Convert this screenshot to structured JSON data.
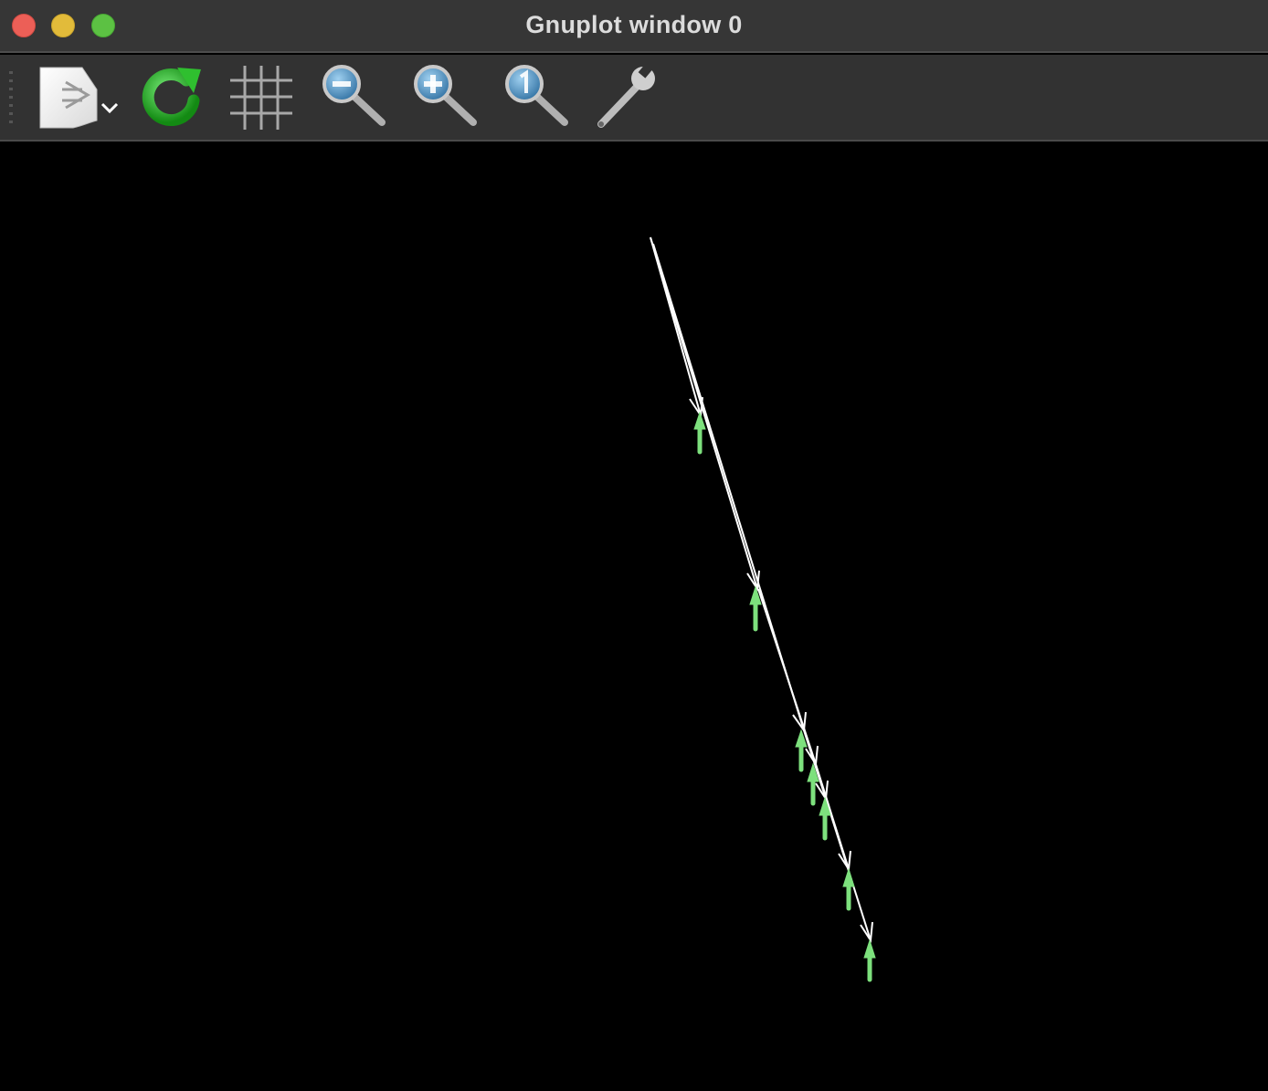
{
  "window": {
    "title": "Gnuplot window 0"
  },
  "toolbar": {
    "items": [
      {
        "name": "export",
        "icon": "export-document-icon"
      },
      {
        "name": "replot",
        "icon": "refresh-icon"
      },
      {
        "name": "grid",
        "icon": "grid-icon"
      },
      {
        "name": "zoom-previous",
        "icon": "zoom-out-icon"
      },
      {
        "name": "zoom-next",
        "icon": "zoom-in-icon"
      },
      {
        "name": "unzoom",
        "icon": "zoom-reset-icon"
      },
      {
        "name": "settings",
        "icon": "wrench-icon"
      }
    ]
  },
  "colors": {
    "background": "#000000",
    "arrow_primary": "#ffffff",
    "arrow_secondary": "#7de07d",
    "replot_green": "#2fbf2f"
  }
}
